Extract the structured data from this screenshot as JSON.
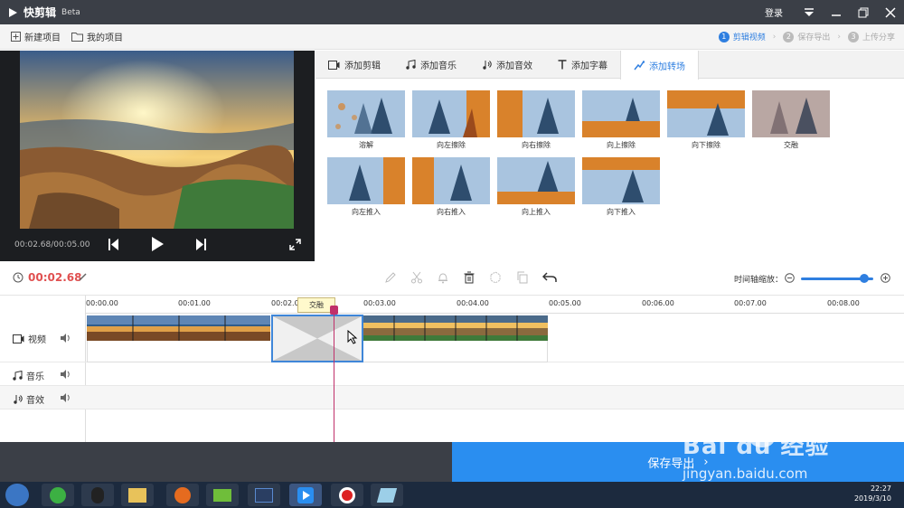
{
  "titlebar": {
    "app": "快剪辑",
    "beta": "Beta",
    "login": "登录"
  },
  "toolbar": {
    "new_project": "新建项目",
    "my_projects": "我的项目"
  },
  "steps": [
    {
      "num": "1",
      "label": "剪辑视频"
    },
    {
      "num": "2",
      "label": "保存导出"
    },
    {
      "num": "3",
      "label": "上传分享"
    }
  ],
  "preview": {
    "timecode": "00:02.68/00:05.00"
  },
  "tabs": [
    "添加剪辑",
    "添加音乐",
    "添加音效",
    "添加字幕",
    "添加转场"
  ],
  "transitions": [
    "溶解",
    "向左擦除",
    "向右擦除",
    "向上擦除",
    "向下擦除",
    "交融",
    "向左推入",
    "向右推入",
    "向上推入",
    "向下推入"
  ],
  "edit": {
    "current_time": "00:02.68",
    "zoom_label": "时间轴缩放："
  },
  "ruler": [
    "00:00.00",
    "00:01.00",
    "00:02.00",
    "00:03.00",
    "00:04.00",
    "00:05.00",
    "00:06.00",
    "00:07.00",
    "00:08.00"
  ],
  "tracks": {
    "video": "视频",
    "music": "音乐",
    "sfx": "音效"
  },
  "transition_tip": "交融",
  "export_button": "保存导出",
  "tray": {
    "time": "22:27",
    "date": "2019/3/10"
  },
  "watermark": {
    "brand": "Bai du 经验",
    "url": "jingyan.baidu.com"
  },
  "colors": {
    "accent": "#2f7fe0",
    "time": "#e05050",
    "playhead": "#c0306a",
    "export": "#2a8ef0"
  }
}
